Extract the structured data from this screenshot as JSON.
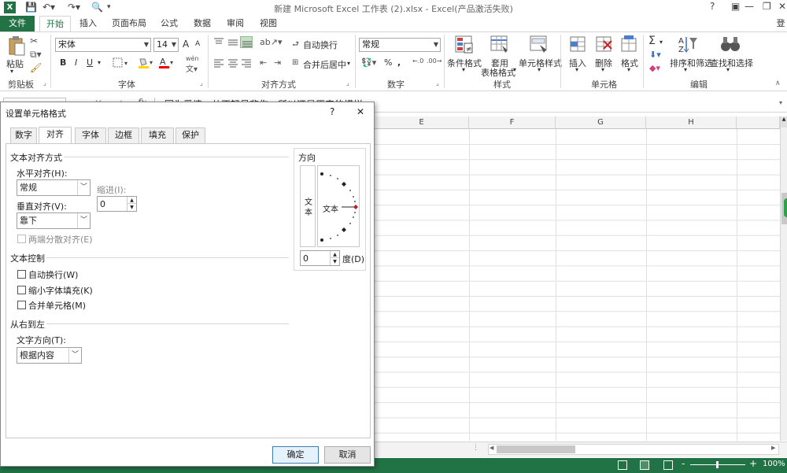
{
  "window": {
    "title": "新建 Microsoft Excel 工作表 (2).xlsx - Excel(产品激活失败)",
    "help": "?",
    "login": "登"
  },
  "tabs": {
    "file": "文件",
    "home": "开始",
    "insert": "插入",
    "layout": "页面布局",
    "formulas": "公式",
    "data": "数据",
    "review": "审阅",
    "view": "视图"
  },
  "ribbon": {
    "clipboard": {
      "paste": "粘贴",
      "group": "剪贴板"
    },
    "font": {
      "name": "宋体",
      "size": "14",
      "group": "字体",
      "bold": "B",
      "italic": "I",
      "underline": "U",
      "grow": "A",
      "shrink": "A",
      "wen": "wén"
    },
    "align": {
      "wrap": "自动换行",
      "merge": "合并后居中",
      "group": "对齐方式"
    },
    "number": {
      "format": "常规",
      "percent": "%",
      "comma": ",",
      "group": "数字"
    },
    "styles": {
      "conditional": "条件格式",
      "table1": "套用",
      "table2": "表格格式",
      "cell": "单元格样式",
      "group": "样式"
    },
    "cells": {
      "insert": "插入",
      "delete": "删除",
      "format": "格式",
      "group": "单元格"
    },
    "editing": {
      "sort": "排序和筛选",
      "find": "查找和选择",
      "group": "编辑",
      "sigma": "Σ"
    }
  },
  "formula_bar": {
    "fx": "fx",
    "content": "因为爱情，从不轻易悲伤，所以还是原来的模样"
  },
  "columns": [
    "E",
    "F",
    "G",
    "H"
  ],
  "status": {
    "zoom": "100%",
    "plus": "+",
    "minus": "-"
  },
  "dialog": {
    "title": "设置单元格格式",
    "help": "?",
    "close": "✕",
    "tabs": [
      "数字",
      "对齐",
      "字体",
      "边框",
      "填充",
      "保护"
    ],
    "text_align_section": "文本对齐方式",
    "horizontal_label": "水平对齐(H):",
    "horizontal_value": "常规",
    "indent_label": "缩进(I):",
    "indent_value": "0",
    "vertical_label": "垂直对齐(V):",
    "vertical_value": "靠下",
    "justify_distributed": "两端分散对齐(E)",
    "text_control_section": "文本控制",
    "wrap_text": "自动换行(W)",
    "shrink_to_fit": "缩小字体填充(K)",
    "merge_cells": "合并单元格(M)",
    "rtl_section": "从右到左",
    "text_direction_label": "文字方向(T):",
    "text_direction_value": "根据内容",
    "orientation_section": "方向",
    "vertical_text": "文本",
    "orientation_text": "文本",
    "degrees_value": "0",
    "degrees_label": "度(D)",
    "ok": "确定",
    "cancel": "取消"
  }
}
